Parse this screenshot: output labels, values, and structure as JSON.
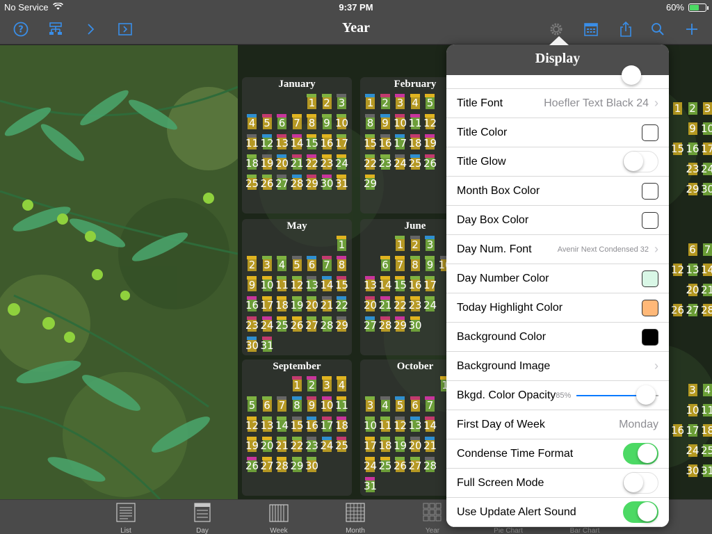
{
  "status_bar": {
    "carrier": "No Service",
    "time": "9:37 PM",
    "battery": "60%",
    "battery_level": 0.6
  },
  "nav": {
    "title": "Year",
    "left_icons": [
      "help-icon",
      "hierarchy-icon",
      "chevron-right-icon",
      "forward-box-icon"
    ],
    "right_icons": [
      "gear-icon",
      "calendar-icon",
      "share-icon",
      "search-icon",
      "add-icon"
    ]
  },
  "calendar": {
    "months": [
      {
        "name": "January",
        "days": [
          [
            "",
            "",
            "",
            "",
            "1",
            "2",
            "3"
          ],
          [
            "4",
            "5",
            "6",
            "7",
            "8",
            "9",
            "10"
          ],
          [
            "11",
            "12",
            "13",
            "14",
            "15",
            "16",
            "17"
          ],
          [
            "18",
            "19",
            "20",
            "21",
            "22",
            "23",
            "24"
          ],
          [
            "25",
            "26",
            "27",
            "28",
            "29",
            "30",
            "31"
          ]
        ]
      },
      {
        "name": "February",
        "days": [
          [
            "1",
            "2",
            "3",
            "4",
            "5",
            "",
            ""
          ],
          [
            "8",
            "9",
            "10",
            "11",
            "12",
            "",
            ""
          ],
          [
            "15",
            "16",
            "17",
            "18",
            "19",
            "",
            ""
          ],
          [
            "22",
            "23",
            "24",
            "25",
            "26",
            "",
            ""
          ],
          [
            "29",
            "",
            "",
            "",
            "",
            "",
            ""
          ]
        ]
      },
      {
        "name": "May",
        "days": [
          [
            "",
            "",
            "",
            "",
            "",
            "",
            "1"
          ],
          [
            "2",
            "3",
            "4",
            "5",
            "6",
            "7",
            "8"
          ],
          [
            "9",
            "10",
            "11",
            "12",
            "13",
            "14",
            "15"
          ],
          [
            "16",
            "17",
            "18",
            "19",
            "20",
            "21",
            "22"
          ],
          [
            "23",
            "24",
            "25",
            "26",
            "27",
            "28",
            "29"
          ],
          [
            "30",
            "31",
            "",
            "",
            "",
            "",
            ""
          ]
        ]
      },
      {
        "name": "June",
        "days": [
          [
            "",
            "",
            "1",
            "2",
            "3",
            "",
            ""
          ],
          [
            "",
            "6",
            "7",
            "8",
            "9",
            "10",
            ""
          ],
          [
            "13",
            "14",
            "15",
            "16",
            "17",
            "",
            ""
          ],
          [
            "20",
            "21",
            "22",
            "23",
            "24",
            "",
            ""
          ],
          [
            "27",
            "28",
            "29",
            "30",
            "",
            "",
            ""
          ]
        ]
      },
      {
        "name": "September",
        "days": [
          [
            "",
            "",
            "",
            "1",
            "2",
            "3",
            "4"
          ],
          [
            "5",
            "6",
            "7",
            "8",
            "9",
            "10",
            "11"
          ],
          [
            "12",
            "13",
            "14",
            "15",
            "16",
            "17",
            "18"
          ],
          [
            "19",
            "20",
            "21",
            "22",
            "23",
            "24",
            "25"
          ],
          [
            "26",
            "27",
            "28",
            "29",
            "30",
            "",
            ""
          ]
        ]
      },
      {
        "name": "October",
        "days": [
          [
            "",
            "",
            "",
            "",
            "",
            "1",
            "2"
          ],
          [
            "3",
            "4",
            "5",
            "6",
            "7",
            "",
            ""
          ],
          [
            "10",
            "11",
            "12",
            "13",
            "14",
            "",
            ""
          ],
          [
            "17",
            "18",
            "19",
            "20",
            "21",
            "",
            ""
          ],
          [
            "24",
            "25",
            "26",
            "27",
            "28",
            "",
            ""
          ],
          [
            "31",
            "",
            "",
            "",
            "",
            "",
            ""
          ]
        ]
      }
    ],
    "right_columns": [
      [
        "1",
        "2",
        "3"
      ],
      [
        "9",
        "10"
      ],
      [
        "15",
        "16",
        "17"
      ],
      [
        "23",
        "24"
      ],
      [
        "29",
        "30"
      ],
      [
        "6",
        "7"
      ],
      [
        "12",
        "13",
        "14"
      ],
      [
        "20",
        "21"
      ],
      [
        "26",
        "27",
        "28"
      ],
      [
        "3",
        "4"
      ],
      [
        "10",
        "11"
      ],
      [
        "16",
        "17",
        "18"
      ],
      [
        "24",
        "25"
      ],
      [
        "30",
        "31"
      ]
    ]
  },
  "popover": {
    "title": "Display",
    "rows": [
      {
        "label": "Title Font",
        "type": "value",
        "value": "Hoefler Text Black 24"
      },
      {
        "label": "Title Color",
        "type": "swatch",
        "color": "#ffffff"
      },
      {
        "label": "Title Glow",
        "type": "toggle",
        "on": false
      },
      {
        "label": "Month Box Color",
        "type": "swatch",
        "color": "#ffffff"
      },
      {
        "label": "Day Box Color",
        "type": "swatch",
        "color": "#ffffff"
      },
      {
        "label": "Day Num. Font",
        "type": "value",
        "value": "Avenir Next Condensed 32",
        "small": true
      },
      {
        "label": "Day Number Color",
        "type": "swatch",
        "color": "#d9f7e6"
      },
      {
        "label": "Today Highlight Color",
        "type": "swatch",
        "color": "#ffb878"
      },
      {
        "label": "Background Color",
        "type": "swatch",
        "color": "#000000"
      },
      {
        "label": "Background Image",
        "type": "chevron"
      },
      {
        "label": "Bkgd. Color Opacity",
        "type": "slider",
        "value": "85%",
        "level": 0.85
      },
      {
        "label": "First Day of Week",
        "type": "plain",
        "value": "Monday"
      },
      {
        "label": "Condense Time Format",
        "type": "toggle",
        "on": true
      },
      {
        "label": "Full Screen Mode",
        "type": "toggle",
        "on": false
      },
      {
        "label": "Use Update Alert Sound",
        "type": "toggle",
        "on": true
      }
    ]
  },
  "tab_bar": {
    "tabs": [
      {
        "label": "List",
        "icon": "list-icon"
      },
      {
        "label": "Day",
        "icon": "day-icon"
      },
      {
        "label": "Week",
        "icon": "week-icon"
      },
      {
        "label": "Month",
        "icon": "month-icon"
      },
      {
        "label": "Year",
        "icon": "year-icon"
      },
      {
        "label": "Pie Chart",
        "icon": "pie-chart-icon"
      },
      {
        "label": "Bar Chart",
        "icon": "bar-chart-icon"
      }
    ]
  },
  "colors": {
    "accent": "#3a8ee8",
    "toggle_on": "#4cd964",
    "bar_bg": "#4a4a4a"
  }
}
